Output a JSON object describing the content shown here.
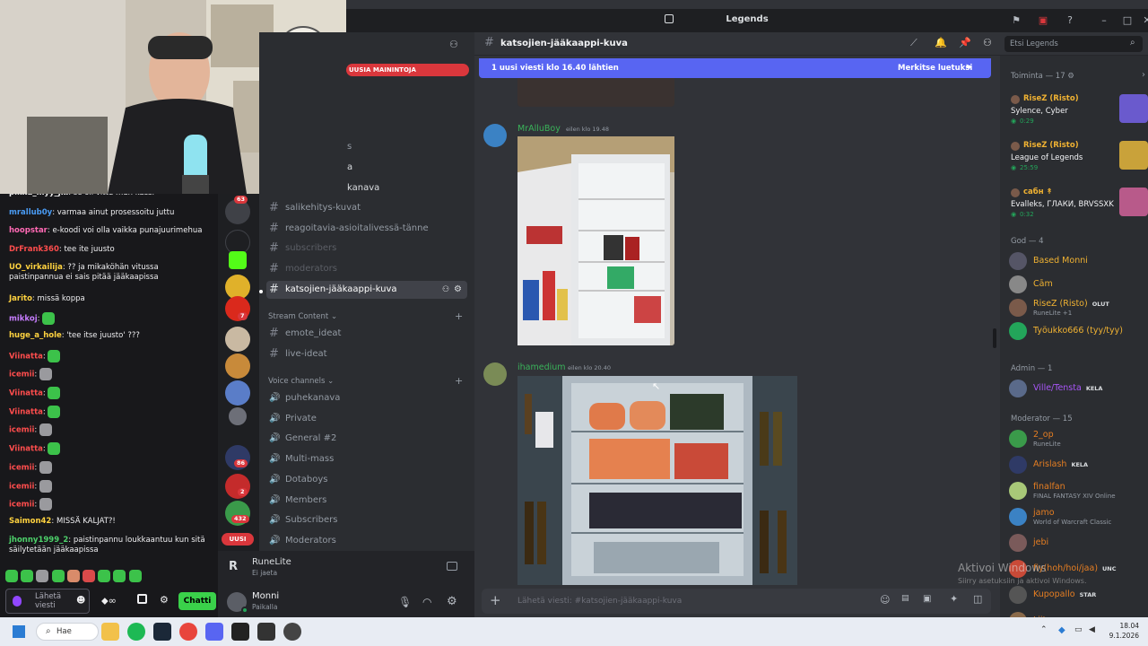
{
  "window": {
    "title": "Legends"
  },
  "header": {
    "channel": "katsojien-jääkaappi-kuva",
    "search_placeholder": "Etsi Legends"
  },
  "new_messages": {
    "text": "1 uusi viesti klo 16.40 lähtien",
    "action": "Merkitse luetuksi"
  },
  "mention_banner": "UUSIA MAININTOJA",
  "channels": {
    "partial": [
      "s",
      "a",
      "kanava"
    ],
    "items": [
      "salikehitys-kuvat",
      "reagoitavia-asioitalivessä-tänne",
      "subscribers",
      "moderators",
      "katsojien-jääkaappi-kuva"
    ],
    "stream_category": "Stream Content",
    "stream": [
      "emote_ideat",
      "live-ideat"
    ],
    "voice_category": "Voice channels",
    "voice": [
      "puhekanava",
      "Private",
      "General #2",
      "Multi-mass",
      "Dotaboys",
      "Members",
      "Subscribers",
      "Moderators"
    ]
  },
  "activity": {
    "name": "RuneLite",
    "status": "Ei jaeta"
  },
  "user": {
    "name": "Monni",
    "status": "Paikalla"
  },
  "server_badges": [
    "63",
    "7",
    "86",
    "2",
    "432"
  ],
  "uusi": "UUSI",
  "messages": [
    {
      "author": "MrAlluBoy",
      "time": "eilen klo 19.48"
    },
    {
      "author": "ihamedium",
      "time": "eilen klo 20.40"
    }
  ],
  "composer": {
    "placeholder": "Lähetä viesti: #katsojien-jääkaappi-kuva"
  },
  "members": {
    "activity_header": "Toiminta — 17",
    "activity": [
      {
        "name": "RiseZ (Risto)",
        "game": "Sylence, Cyber",
        "time": "0:29"
      },
      {
        "name": "RiseZ (Risto)",
        "game": "League of Legends",
        "time": "25:59"
      },
      {
        "name": "сабн ↟",
        "game": "Evalleks, ГЛАКИ, BRVSSXK",
        "time": "0:32"
      }
    ],
    "god_header": "God — 4",
    "god": [
      {
        "name": "Based Monni",
        "sub": "",
        "tag": ""
      },
      {
        "name": "Cām",
        "sub": "",
        "tag": ""
      },
      {
        "name": "RiseZ (Risto)",
        "sub": "RuneLite +1",
        "tag": "OLUT"
      },
      {
        "name": "Työukko666 (tyy/tyy)",
        "sub": "",
        "tag": ""
      }
    ],
    "admin_header": "Admin — 1",
    "admin": [
      {
        "name": "Ville/Tensta",
        "tag": "KELA"
      }
    ],
    "mod_header": "Moderator — 15",
    "mods": [
      {
        "name": "2_op",
        "sub": "RuneLite",
        "tag": ""
      },
      {
        "name": "Arislash",
        "sub": "",
        "tag": "KELA"
      },
      {
        "name": "finalfan",
        "sub": "FINAL FANTASY XIV Online",
        "tag": ""
      },
      {
        "name": "jamo",
        "sub": "World of Warcraft Classic",
        "tag": ""
      },
      {
        "name": "jebi",
        "sub": "",
        "tag": ""
      },
      {
        "name": "fiy(hoh/hoi/jaa)",
        "sub": "",
        "tag": "UNC"
      },
      {
        "name": "Kupopallo",
        "sub": "",
        "tag": "STAR"
      },
      {
        "name": "Liitamanga",
        "sub": "",
        "tag": ""
      }
    ]
  },
  "watermark": {
    "line1": "Aktivoi Windows",
    "line2": "Siirry asetuksiin ja aktivoi Windows."
  },
  "twitch_chat": [
    {
      "user": "pikku_myy_jki",
      "color": "#f3f3f3",
      "text": "se oli vittu mun kassi"
    },
    {
      "user": "mrallub0y",
      "color": "#4a9cf5",
      "text": "varmaa ainut prosessoitu juttu"
    },
    {
      "user": "hoopstar",
      "color": "#ff69b4",
      "text": "e-koodi voi olla vaikka punajuurimehua"
    },
    {
      "user": "DrFrank360",
      "color": "#ff4d4d",
      "text": "tee ite juusto"
    },
    {
      "user": "UO_virkailija",
      "color": "#ffd23f",
      "text": "?? ja mikaköhän vitussa paistinpannua ei sais pitää jääkaapissa"
    },
    {
      "user": "Jarito",
      "color": "#ffd23f",
      "text": "missä koppa"
    },
    {
      "user": "mikkoj",
      "color": "#c77dff",
      "text": ""
    },
    {
      "user": "huge_a_hole",
      "color": "#ffd23f",
      "text": "'tee itse juusto' ???"
    },
    {
      "user": "Viinatta",
      "color": "#ff4d4d",
      "text": ""
    },
    {
      "user": "icemii",
      "color": "#ff4d4d",
      "text": ""
    },
    {
      "user": "Viinatta",
      "color": "#ff4d4d",
      "text": ""
    },
    {
      "user": "Viinatta",
      "color": "#ff4d4d",
      "text": ""
    },
    {
      "user": "icemii",
      "color": "#ff4d4d",
      "text": ""
    },
    {
      "user": "Viinatta",
      "color": "#ff4d4d",
      "text": ""
    },
    {
      "user": "icemii",
      "color": "#ff4d4d",
      "text": ""
    },
    {
      "user": "icemii",
      "color": "#ff4d4d",
      "text": ""
    },
    {
      "user": "icemii",
      "color": "#ff4d4d",
      "text": ""
    },
    {
      "user": "Saimon42",
      "color": "#ffd23f",
      "text": "MISSÄ KALJAT?!"
    },
    {
      "user": "jhonny1999_2",
      "color": "#4dd26b",
      "text": "paistinpannu loukkaantuu kun sitä säilytetään jääkaapissa"
    }
  ],
  "chat_input": {
    "placeholder": "Lähetä viesti",
    "send": "Chatti"
  },
  "taskbar": {
    "search": "Hae",
    "time": "18.04",
    "date": "9.1.2026"
  }
}
